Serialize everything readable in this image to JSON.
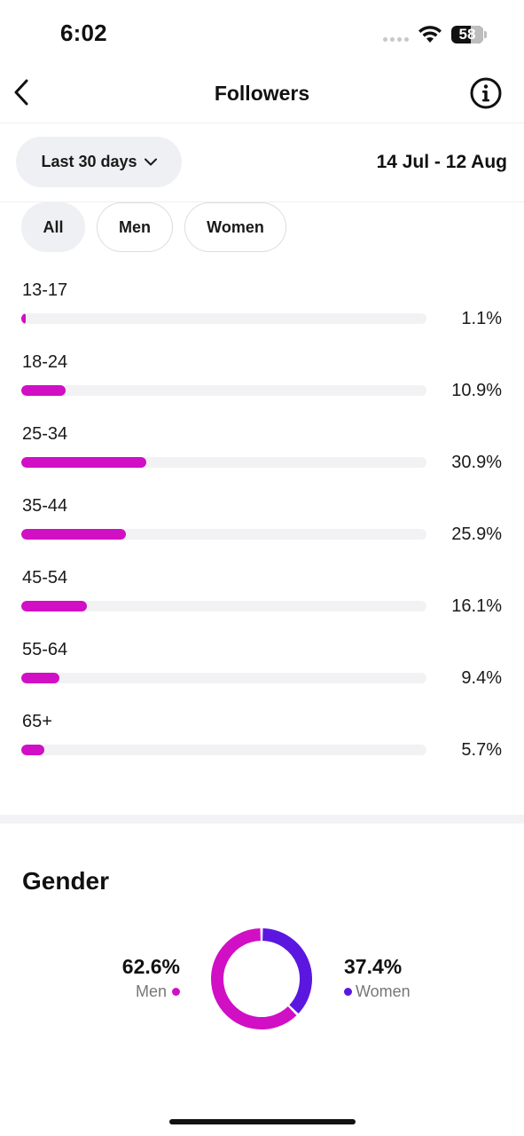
{
  "status_bar": {
    "time": "6:02",
    "battery": "58"
  },
  "header": {
    "title": "Followers",
    "back_icon": "chevron-left-icon",
    "info_icon": "info-icon"
  },
  "range": {
    "dropdown_label": "Last 30 days",
    "dates": "14 Jul - 12 Aug"
  },
  "segments": [
    {
      "label": "All",
      "active": true
    },
    {
      "label": "Men",
      "active": false
    },
    {
      "label": "Women",
      "active": false
    }
  ],
  "colors": {
    "bar": "#d10fc4",
    "men": "#d10fc4",
    "women": "#5b17e0"
  },
  "age_ranges": [
    {
      "label": "13-17",
      "value": 1.1,
      "pct": "1.1%"
    },
    {
      "label": "18-24",
      "value": 10.9,
      "pct": "10.9%"
    },
    {
      "label": "25-34",
      "value": 30.9,
      "pct": "30.9%"
    },
    {
      "label": "35-44",
      "value": 25.9,
      "pct": "25.9%"
    },
    {
      "label": "45-54",
      "value": 16.1,
      "pct": "16.1%"
    },
    {
      "label": "55-64",
      "value": 9.4,
      "pct": "9.4%"
    },
    {
      "label": "65+",
      "value": 5.7,
      "pct": "5.7%"
    }
  ],
  "gender": {
    "title": "Gender",
    "men": {
      "label": "Men",
      "value": 62.6,
      "pct": "62.6%"
    },
    "women": {
      "label": "Women",
      "value": 37.4,
      "pct": "37.4%"
    }
  }
}
